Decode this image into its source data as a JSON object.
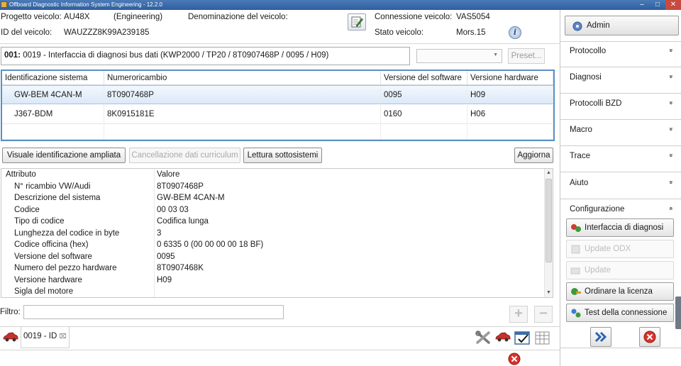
{
  "window": {
    "title": "Offboard Diagnostic Information System Engineering - 12.2.0"
  },
  "vehicle_info": {
    "project_label": "Progetto veicolo:",
    "project_value": "AU48X",
    "project_mode": "(Engineering)",
    "name_label": "Denominazione del veicolo:",
    "id_label": "ID del veicolo:",
    "id_value": "WAUZZZ8K99A239185",
    "connection_label": "Connessione veicolo:",
    "connection_value": "VAS5054",
    "state_label": "Stato veicolo:",
    "state_value": "Mors.15"
  },
  "ecu": {
    "number": "001:",
    "title": "0019 - Interfaccia di diagnosi bus dati  (KWP2000 / TP20 / 8T0907468P / 0095 / H09)",
    "preset_select_value": "",
    "preset_button": "Preset..."
  },
  "subsystems": {
    "columns": [
      "Identificazione sistema",
      "Numeroricambio",
      "Versione del software",
      "Versione hardware"
    ],
    "rows": [
      [
        "GW-BEM 4CAN-M",
        "8T0907468P",
        "0095",
        "H09"
      ],
      [
        "J367-BDM",
        "8K0915181E",
        "0160",
        "H06"
      ]
    ]
  },
  "action_buttons": {
    "extended_id": "Visuale identificazione ampliata",
    "clear_history": "Cancellazione dati curriculum",
    "read_subsystems": "Lettura sottosistemi",
    "refresh": "Aggiorna"
  },
  "attributes": {
    "columns": [
      "Attributo",
      "Valore"
    ],
    "rows": [
      [
        "N° ricambio VW/Audi",
        "8T0907468P"
      ],
      [
        "Descrizione del sistema",
        "GW-BEM 4CAN-M"
      ],
      [
        "Codice",
        "00 03 03"
      ],
      [
        "Tipo di codice",
        "Codifica lunga"
      ],
      [
        "Lunghezza del codice in byte",
        "3"
      ],
      [
        "Codice officina (hex)",
        "0 6335 0 (00 00 00 00 18 BF)"
      ],
      [
        "Versione del software",
        "0095"
      ],
      [
        "Numero del pezzo hardware",
        "8T0907468K"
      ],
      [
        "Versione hardware",
        "H09"
      ],
      [
        "Sigla del motore",
        ""
      ]
    ]
  },
  "filter": {
    "label": "Filtro:",
    "value": ""
  },
  "tabs": [
    {
      "label": "0019 - ID",
      "close": "⌧"
    }
  ],
  "right_panel": {
    "user_button": "Admin",
    "sections": [
      {
        "label": "Protocollo",
        "chevron": "»"
      },
      {
        "label": "Diagnosi",
        "chevron": "»"
      },
      {
        "label": "Protocolli BZD",
        "chevron": "»"
      },
      {
        "label": "Macro",
        "chevron": "»"
      },
      {
        "label": "Trace",
        "chevron": "»"
      },
      {
        "label": "Aiuto",
        "chevron": "»"
      },
      {
        "label": "Configurazione",
        "chevron": "«"
      }
    ],
    "config_buttons": [
      {
        "label": "Interfaccia di diagnosi",
        "enabled": true,
        "icon": "diagnostic-interface-icon"
      },
      {
        "label": "Update ODX",
        "enabled": false,
        "icon": "update-odx-icon"
      },
      {
        "label": "Update",
        "enabled": false,
        "icon": "update-icon"
      },
      {
        "label": "Ordinare la licenza",
        "enabled": true,
        "icon": "license-icon"
      },
      {
        "label": "Test della connessione",
        "enabled": true,
        "icon": "connection-test-icon"
      }
    ]
  },
  "colors": {
    "accent_blue": "#5b8fc4",
    "selection": "#dce9f8",
    "close_red": "#d9332b",
    "title_bar": "#3b6aa8"
  }
}
